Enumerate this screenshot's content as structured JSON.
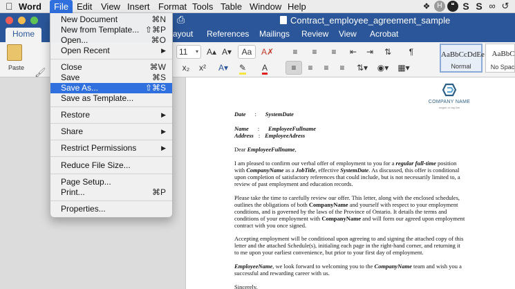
{
  "menubar": {
    "app_name": "Word",
    "items": [
      "File",
      "Edit",
      "View",
      "Insert",
      "Format",
      "Tools",
      "Table",
      "Window",
      "Help"
    ],
    "active": "File",
    "status_icons": [
      "dropbox-icon",
      "chrome-extension-icon",
      "hangouts-icon",
      "skype-icon",
      "shazam-icon",
      "creative-cloud-icon",
      "time-machine-icon"
    ]
  },
  "window": {
    "title": "Contract_employee_agreement_sample"
  },
  "ribbon_tabs": [
    "Home",
    "Layout",
    "References",
    "Mailings",
    "Review",
    "View",
    "Acrobat"
  ],
  "ribbon_tabs_visible_text": {
    "home": "Home",
    "layout": "ayout",
    "references": "References",
    "mailings": "Mailings",
    "review": "Review",
    "view": "View",
    "acrobat": "Acrobat"
  },
  "ribbon": {
    "paste_label": "Paste",
    "font_size": "11",
    "styles": [
      {
        "sample": "AaBbCcDdEe",
        "label": "Normal"
      },
      {
        "sample": "AaBbCcDdEe",
        "label": "No Spacing"
      }
    ],
    "grow_font": "A▴",
    "shrink_font": "A▾",
    "subscript": "x₂",
    "superscript": "x²"
  },
  "file_menu": {
    "items": [
      {
        "label": "New Document",
        "shortcut": "⌘N"
      },
      {
        "label": "New from Template...",
        "shortcut": "⇧⌘P"
      },
      {
        "label": "Open...",
        "shortcut": "⌘O"
      },
      {
        "label": "Open Recent",
        "submenu": true
      },
      {
        "label": "Close",
        "shortcut": "⌘W"
      },
      {
        "label": "Save",
        "shortcut": "⌘S"
      },
      {
        "label": "Save As...",
        "shortcut": "⇧⌘S",
        "highlighted": true
      },
      {
        "label": "Save as Template..."
      },
      {
        "label": "Restore",
        "submenu": true
      },
      {
        "label": "Share",
        "submenu": true
      },
      {
        "label": "Restrict Permissions",
        "submenu": true
      },
      {
        "label": "Reduce File Size..."
      },
      {
        "label": "Page Setup..."
      },
      {
        "label": "Print...",
        "shortcut": "⌘P"
      },
      {
        "label": "Properties..."
      }
    ]
  },
  "document": {
    "logo": {
      "name": "COMPANY NAME",
      "tagline": "slogan or tag line"
    },
    "date_label": "Date",
    "date_value": "SystemDate",
    "name_label": "Name",
    "name_value": "EmployeeFullname",
    "address_label": "Address",
    "address_value": "EmployeeAdress",
    "salutation_prefix": "Dear ",
    "salutation_name": "EmployeeFullname",
    "salutation_suffix": ",",
    "p1": [
      "I am pleased to confirm our verbal offer of employment to you for a ",
      "regular full-time",
      " position",
      "with ",
      "CompanyName",
      " as a ",
      "JobTitle",
      ", effective ",
      "SystemDate",
      ". As discussed, this offer is conditional",
      "upon completion of satisfactory references that could include, but is not necessarily limited to, a",
      "review of past employment and education records."
    ],
    "p2": [
      "Please take the time to carefully review our offer. This letter, along with the enclosed schedules,",
      "outlines the obligations of both ",
      "CompanyName",
      " and yourself with respect to your employment",
      "conditions, and is governed by the laws of the Province of Ontario. It details the terms and",
      "conditions of your employment with ",
      "CompanyName",
      " and will form our agreed upon employment",
      "contract with you once signed."
    ],
    "p3": [
      "Accepting employment will be conditional upon agreeing to and signing the attached copy of this",
      "letter and the attached Schedule(s), initialing each page in the right-hand corner, and returning it",
      "to me upon your earliest convenience, but prior to your first day of employment."
    ],
    "p4": [
      "EmployeeName",
      ", we look forward to welcoming you to the ",
      "CompanyName",
      "  team and wish you a",
      "successful and rewarding career with us."
    ],
    "closing": "Sincerely,"
  },
  "colors": {
    "word_blue": "#2b579a",
    "menu_highlight": "#2f6fde",
    "logo_blue": "#2c5f85"
  }
}
